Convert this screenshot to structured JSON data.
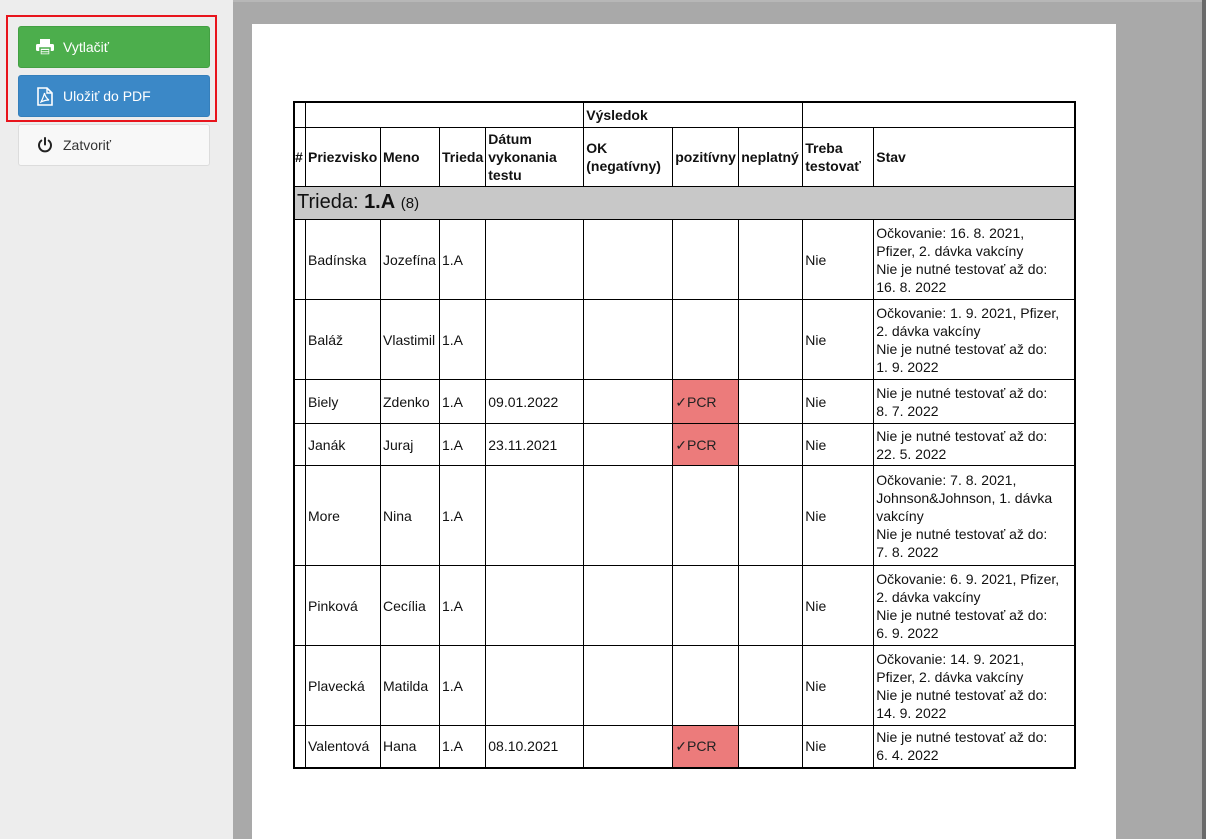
{
  "sidebar": {
    "print_label": "Vytlačiť",
    "pdf_label": "Uložiť do PDF",
    "close_label": "Zatvoriť"
  },
  "table": {
    "group_header": "Výsledok",
    "columns": {
      "index": "#",
      "surname": "Priezvisko",
      "name": "Meno",
      "class": "Trieda",
      "date": "Dátum vykonania testu",
      "ok": "OK (negatívny)",
      "positive": "pozitívny",
      "invalid": "neplatný",
      "need_test": "Treba testovať",
      "status": "Stav"
    },
    "class_group": {
      "prefix": "Trieda: ",
      "name": "1.A",
      "count": "(8)"
    },
    "rows": [
      {
        "surname": "Badínska",
        "name": "Jozefína",
        "class": "1.A",
        "date": "",
        "ok": "",
        "positive": "",
        "invalid": "",
        "need_test": "Nie",
        "status_lines": [
          "Očkovanie: 16. 8. 2021,",
          "Pfizer, 2. dávka vakcíny",
          "Nie je nutné testovať až do:",
          "16. 8. 2022"
        ]
      },
      {
        "surname": "Baláž",
        "name": "Vlastimil",
        "class": "1.A",
        "date": "",
        "ok": "",
        "positive": "",
        "invalid": "",
        "need_test": "Nie",
        "status_lines": [
          "Očkovanie: 1. 9. 2021, Pfizer,",
          "2. dávka vakcíny",
          "Nie je nutné testovať až do:",
          "1. 9. 2022"
        ]
      },
      {
        "surname": "Biely",
        "name": "Zdenko",
        "class": "1.A",
        "date": "09.01.2022",
        "ok": "",
        "positive": "✓PCR",
        "invalid": "",
        "need_test": "Nie",
        "status_lines": [
          "Nie je nutné testovať až do:",
          "8. 7. 2022"
        ]
      },
      {
        "surname": "Janák",
        "name": "Juraj",
        "class": "1.A",
        "date": "23.11.2021",
        "ok": "",
        "positive": "✓PCR",
        "invalid": "",
        "need_test": "Nie",
        "status_lines": [
          "Nie je nutné testovať až do:",
          "22. 5. 2022"
        ]
      },
      {
        "surname": "More",
        "name": "Nina",
        "class": "1.A",
        "date": "",
        "ok": "",
        "positive": "",
        "invalid": "",
        "need_test": "Nie",
        "status_lines": [
          "Očkovanie: 7. 8. 2021,",
          "Johnson&Johnson, 1. dávka",
          "vakcíny",
          "Nie je nutné testovať až do:",
          "7. 8. 2022"
        ]
      },
      {
        "surname": "Pinková",
        "name": "Cecília",
        "class": "1.A",
        "date": "",
        "ok": "",
        "positive": "",
        "invalid": "",
        "need_test": "Nie",
        "status_lines": [
          "Očkovanie: 6. 9. 2021, Pfizer,",
          "2. dávka vakcíny",
          "Nie je nutné testovať až do:",
          "6. 9. 2022"
        ]
      },
      {
        "surname": "Plavecká",
        "name": "Matilda",
        "class": "1.A",
        "date": "",
        "ok": "",
        "positive": "",
        "invalid": "",
        "need_test": "Nie",
        "status_lines": [
          "Očkovanie: 14. 9. 2021,",
          "Pfizer, 2. dávka vakcíny",
          "Nie je nutné testovať až do:",
          "14. 9. 2022"
        ]
      },
      {
        "surname": "Valentová",
        "name": "Hana",
        "class": "1.A",
        "date": "08.10.2021",
        "ok": "",
        "positive": "✓PCR",
        "invalid": "",
        "need_test": "Nie",
        "status_lines": [
          "Nie je nutné testovať až do:",
          "6. 4. 2022"
        ]
      }
    ]
  }
}
